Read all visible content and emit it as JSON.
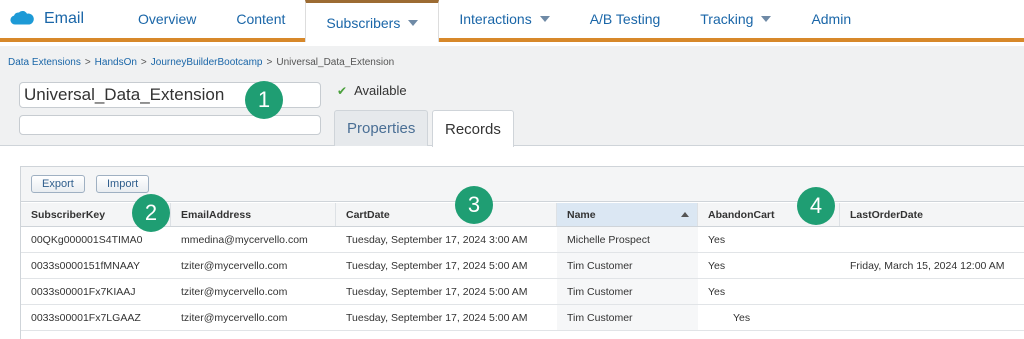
{
  "app": {
    "name": "Email"
  },
  "nav": [
    {
      "label": "Overview",
      "dropdown": false,
      "active": false
    },
    {
      "label": "Content",
      "dropdown": false,
      "active": false
    },
    {
      "label": "Subscribers",
      "dropdown": true,
      "active": true
    },
    {
      "label": "Interactions",
      "dropdown": true,
      "active": false
    },
    {
      "label": "A/B Testing",
      "dropdown": false,
      "active": false
    },
    {
      "label": "Tracking",
      "dropdown": true,
      "active": false
    },
    {
      "label": "Admin",
      "dropdown": false,
      "active": false
    }
  ],
  "breadcrumb": [
    "Data Extensions",
    "HandsOn",
    "JourneyBuilderBootcamp",
    "Universal_Data_Extension"
  ],
  "breadcrumb_separator": ">",
  "extension": {
    "name": "Universal_Data_Extension",
    "description": "",
    "status": "Available"
  },
  "tabs": {
    "properties": "Properties",
    "records": "Records"
  },
  "toolbar": {
    "export_label": "Export",
    "import_label": "Import"
  },
  "markers": [
    "1",
    "2",
    "3",
    "4"
  ],
  "table": {
    "columns": [
      "SubscriberKey",
      "EmailAddress",
      "CartDate",
      "Name",
      "AbandonCart",
      "LastOrderDate"
    ],
    "sorted_column": "Name",
    "rows": [
      [
        "00QKg000001S4TIMA0",
        "mmedina@mycervello.com",
        "Tuesday, September 17, 2024 3:00 AM",
        "Michelle Prospect",
        "Yes",
        ""
      ],
      [
        "0033s0000151fMNAAY",
        "tziter@mycervello.com",
        "Tuesday, September 17, 2024 5:00 AM",
        "Tim Customer",
        "Yes",
        "Friday, March 15, 2024 12:00 AM"
      ],
      [
        "0033s00001Fx7KIAAJ",
        "tziter@mycervello.com",
        "Tuesday, September 17, 2024 5:00 AM",
        "Tim Customer",
        "Yes",
        ""
      ],
      [
        "0033s00001Fx7LGAAZ",
        "tziter@mycervello.com",
        "Tuesday, September 17, 2024 5:00 AM",
        "Tim Customer",
        "Yes",
        ""
      ]
    ]
  },
  "colors": {
    "accent_bar": "#d7882a",
    "link": "#1a66a8",
    "marker": "#1f9e73",
    "check": "#4aa03c"
  }
}
